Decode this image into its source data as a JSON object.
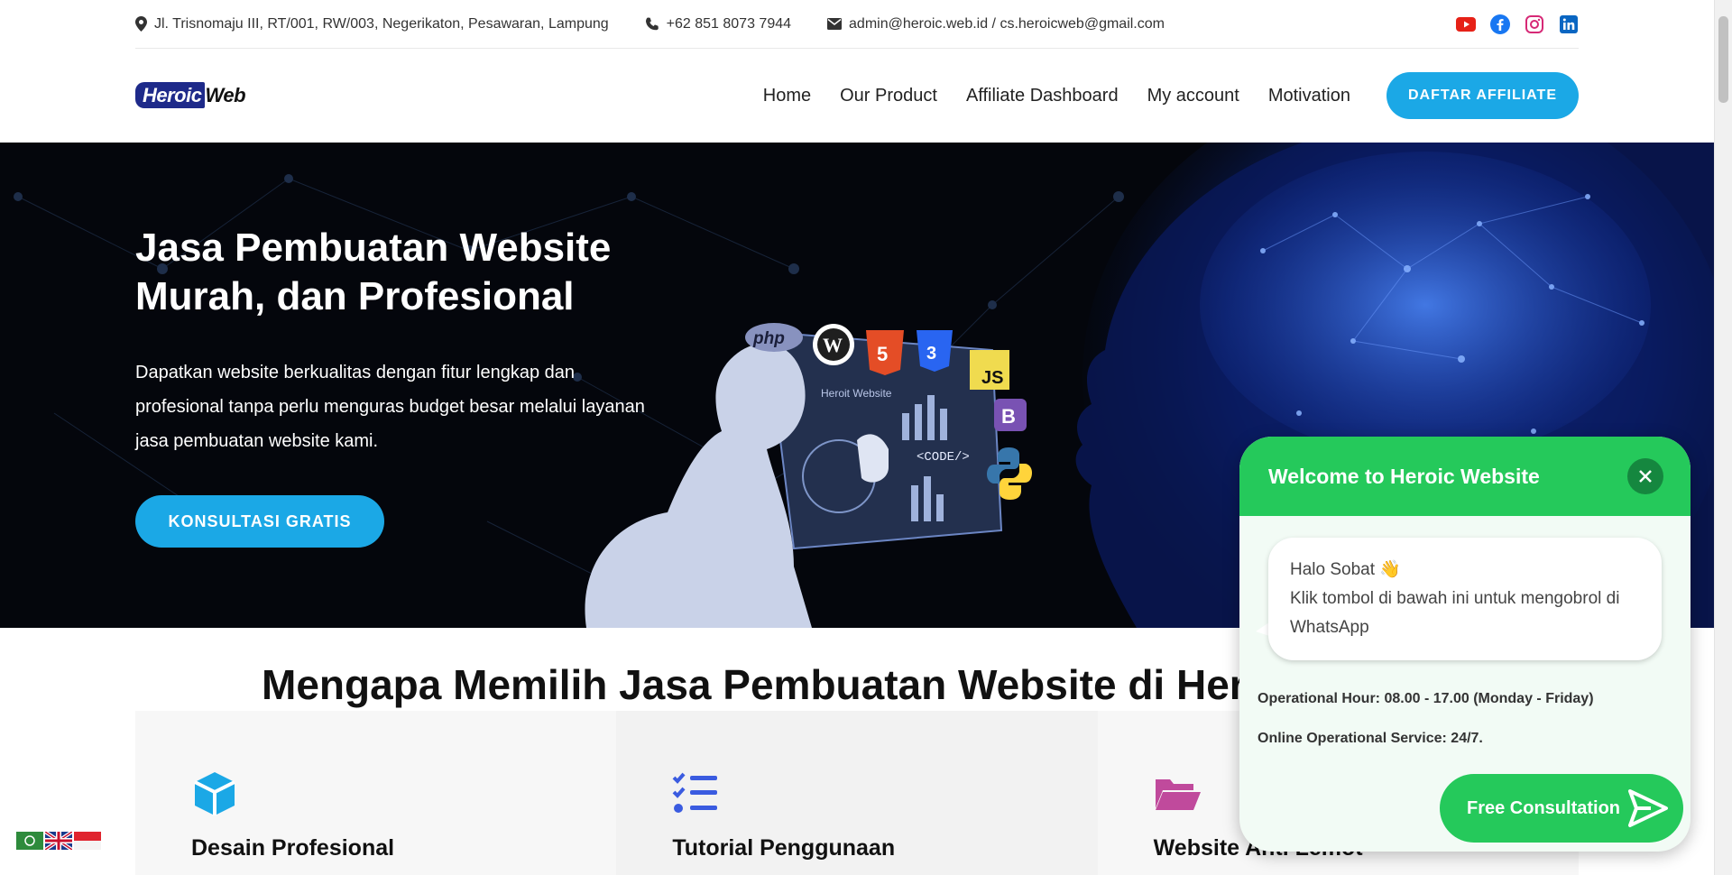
{
  "topbar": {
    "address": "Jl. Trisnomaju III, RT/001, RW/003, Negerikaton, Pesawaran, Lampung",
    "phone": "+62 851 8073 7944",
    "email": "admin@heroic.web.id / cs.heroicweb@gmail.com",
    "social_icons": [
      "youtube-icon",
      "facebook-icon",
      "instagram-icon",
      "linkedin-icon"
    ]
  },
  "header": {
    "logo_part1": "Heroic",
    "logo_part2": "Web",
    "nav": [
      "Home",
      "Our Product",
      "Affiliate Dashboard",
      "My account",
      "Motivation"
    ],
    "cta": "DAFTAR AFFILIATE"
  },
  "hero": {
    "title": "Jasa Pembuatan Website Murah, dan Profesional",
    "description": "Dapatkan website berkualitas dengan fitur lengkap dan profesional tanpa perlu menguras budget besar melalui layanan jasa pembuatan website kami.",
    "cta": "KONSULTASI GRATIS",
    "tech_logos": [
      "php",
      "JS",
      "B"
    ],
    "screen_label": "Heroit Website",
    "code_label": "<CODE/>"
  },
  "section": {
    "title": "Mengapa Memilih Jasa Pembuatan Website di Her",
    "cards": [
      {
        "icon": "box-icon",
        "title": "Desain Profesional"
      },
      {
        "icon": "checklist-icon",
        "title": "Tutorial Penggunaan"
      },
      {
        "icon": "folder-icon",
        "title": "Website Anti Lemot"
      }
    ]
  },
  "chat": {
    "title": "Welcome to Heroic Website",
    "greeting": "Halo Sobat 👋",
    "message": "Klik tombol di bawah ini untuk mengobrol di WhatsApp",
    "hours": "Operational Hour: 08.00 - 17.00 (Monday - Friday)",
    "online": "Online Operational Service: 24/7.",
    "cta": "Free Consultation"
  },
  "colors": {
    "accent": "#1ba8e6",
    "whatsapp": "#25c95b",
    "hero_bg": "#04060c"
  }
}
